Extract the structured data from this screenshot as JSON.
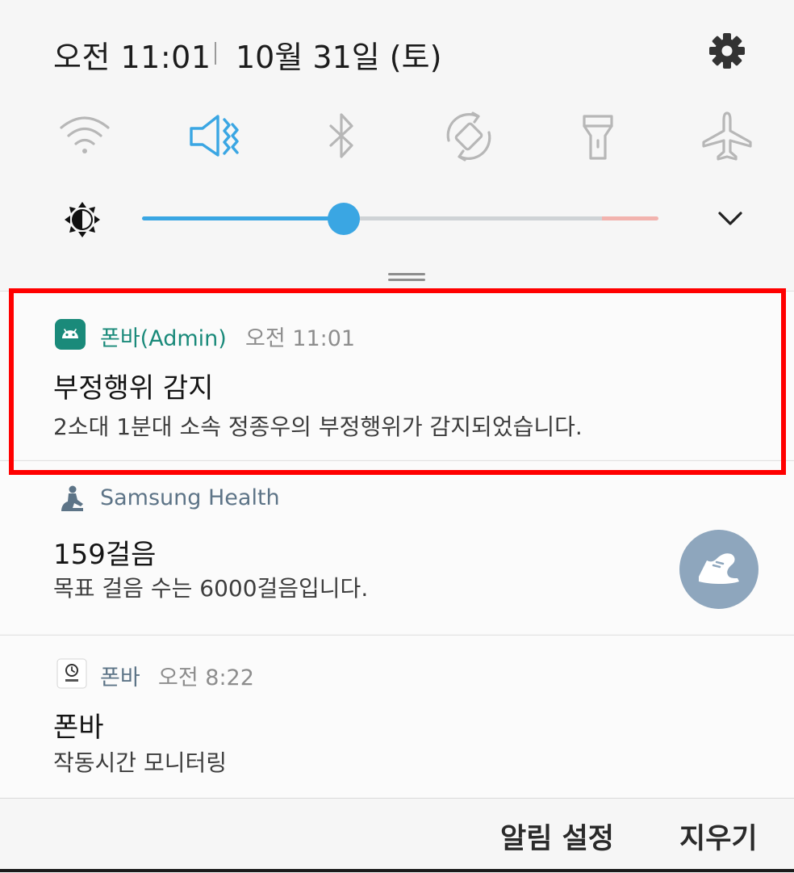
{
  "status": {
    "time": "오전 11:01",
    "date": "10월 31일 (토)"
  },
  "quick_settings": {
    "toggles": [
      {
        "name": "wifi-icon",
        "active": false
      },
      {
        "name": "vibrate-icon",
        "active": true
      },
      {
        "name": "bluetooth-icon",
        "active": false
      },
      {
        "name": "auto-rotate-icon",
        "active": false
      },
      {
        "name": "flashlight-icon",
        "active": false
      },
      {
        "name": "airplane-mode-icon",
        "active": false
      }
    ],
    "brightness_level": 0.39,
    "accent_color": "#3aa6e3"
  },
  "notifications": [
    {
      "app": "폰바(Admin)",
      "time": "오전 11:01",
      "title": "부정행위 감지",
      "body": "2소대 1분대 소속 정종우의 부정행위가 감지되었습니다.",
      "app_color": "#1a8a7a",
      "highlighted": true
    },
    {
      "app": "Samsung Health",
      "title": "159걸음",
      "body": "목표 걸음 수는 6000걸음입니다.",
      "app_color": "#5d7487"
    },
    {
      "app": "폰바",
      "time": "오전 8:22",
      "title": "폰바",
      "body": "작동시간 모니터링",
      "app_color": "#5d7487"
    }
  ],
  "footer": {
    "settings_label": "알림 설정",
    "clear_label": "지우기"
  },
  "highlight_color": "#ff0000"
}
